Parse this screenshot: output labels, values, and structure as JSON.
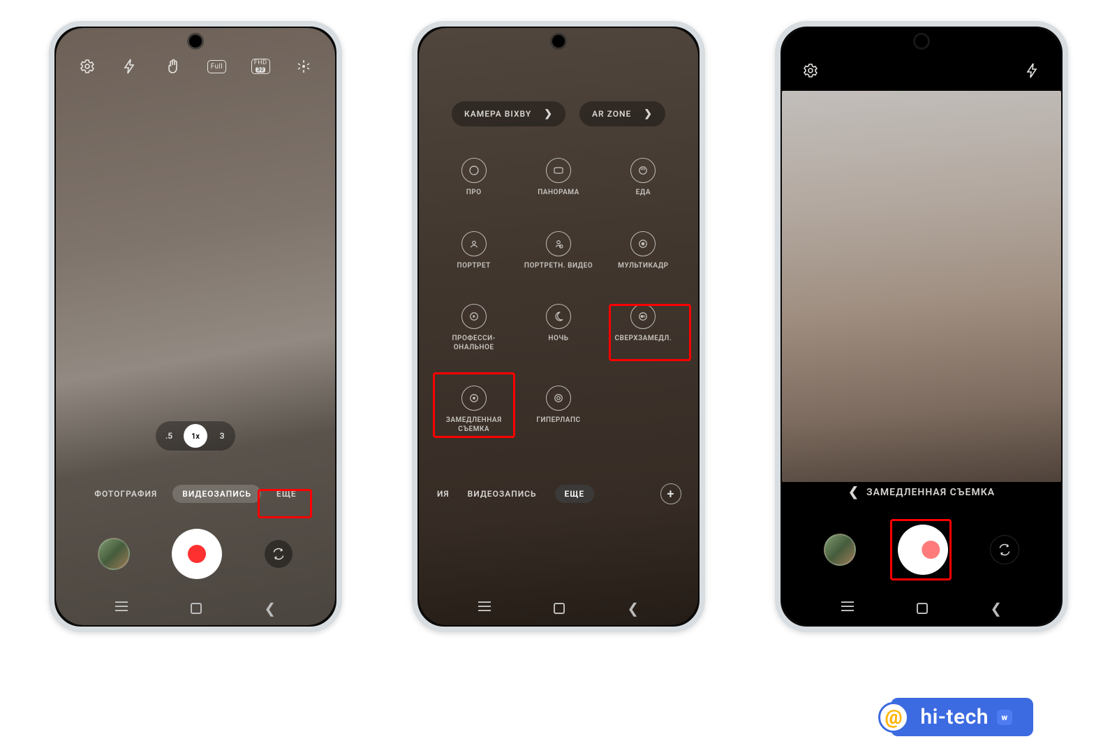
{
  "watermark": {
    "text": "hi-tech",
    "vk": "w"
  },
  "phone1": {
    "toolbar_icons": [
      "settings",
      "flash",
      "palm",
      "full",
      "fhd30",
      "filters"
    ],
    "fhd_top": "FHD",
    "fhd_bottom": "30",
    "full": "Full",
    "zoom": {
      "a": ".5",
      "b": "1x",
      "c": "3"
    },
    "modes": {
      "left": "ФОТОГРАФИЯ",
      "center": "ВИДЕОЗАПИСЬ",
      "right": "ЕЩЕ"
    }
  },
  "phone2": {
    "pills": {
      "a": "КАМЕРА BIXBY",
      "b": "AR ZONE"
    },
    "grid": [
      {
        "label": "ПРО"
      },
      {
        "label": "ПАНОРАМА"
      },
      {
        "label": "ЕДА"
      },
      {
        "label": "ПОРТРЕТ"
      },
      {
        "label": "ПОРТРЕТН. ВИДЕО"
      },
      {
        "label": "МУЛЬТИКАДР"
      },
      {
        "label": "ПРОФЕССИ-ОНАЛЬНОЕ"
      },
      {
        "label": "НОЧЬ"
      },
      {
        "label": "СВЕРХЗАМЕДЛ."
      },
      {
        "label": "ЗАМЕДЛЕННАЯ СЪЕМКА"
      },
      {
        "label": "ГИПЕРЛАПС"
      }
    ],
    "modes": {
      "left": "ИЯ",
      "center": "ВИДЕОЗАПИСЬ",
      "right": "ЕЩЕ"
    }
  },
  "phone3": {
    "mode_label": "ЗАМЕДЛЕННАЯ СЪЕМКА"
  }
}
